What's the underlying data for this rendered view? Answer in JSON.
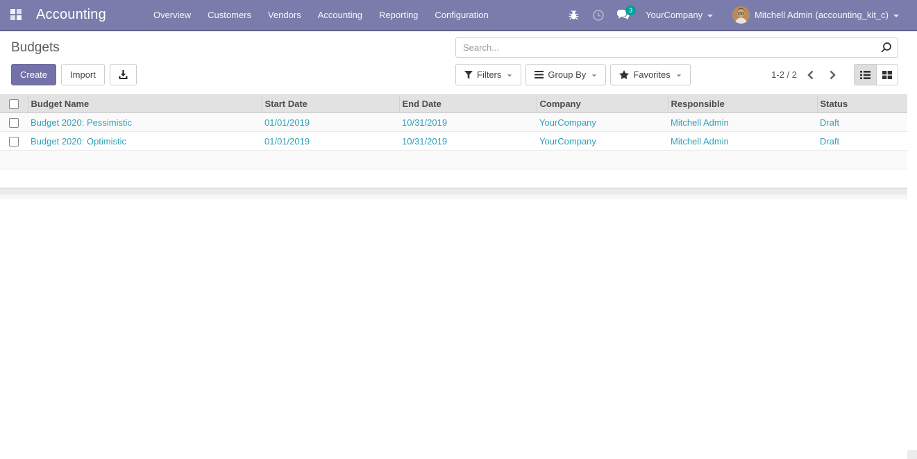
{
  "navbar": {
    "brand": "Accounting",
    "menus": [
      "Overview",
      "Customers",
      "Vendors",
      "Accounting",
      "Reporting",
      "Configuration"
    ],
    "systray": {
      "messages_badge": "3",
      "company": "YourCompany",
      "user": "Mitchell Admin (accounting_kit_c)"
    }
  },
  "control_panel": {
    "title": "Budgets",
    "search_placeholder": "Search...",
    "create_label": "Create",
    "import_label": "Import",
    "filters_label": "Filters",
    "group_by_label": "Group By",
    "favorites_label": "Favorites",
    "pager_text": "1-2 / 2"
  },
  "table": {
    "columns": [
      "Budget Name",
      "Start Date",
      "End Date",
      "Company",
      "Responsible",
      "Status"
    ],
    "rows": [
      {
        "name": "Budget 2020: Pessimistic",
        "start": "01/01/2019",
        "end": "10/31/2019",
        "company": "YourCompany",
        "responsible": "Mitchell Admin",
        "status": "Draft"
      },
      {
        "name": "Budget 2020: Optimistic",
        "start": "01/01/2019",
        "end": "10/31/2019",
        "company": "YourCompany",
        "responsible": "Mitchell Admin",
        "status": "Draft"
      }
    ]
  },
  "colors": {
    "navbar_bg": "#7A7DAB",
    "primary_button": "#7471A9",
    "record_link": "#2F9FB8",
    "badge": "#00A09D"
  }
}
